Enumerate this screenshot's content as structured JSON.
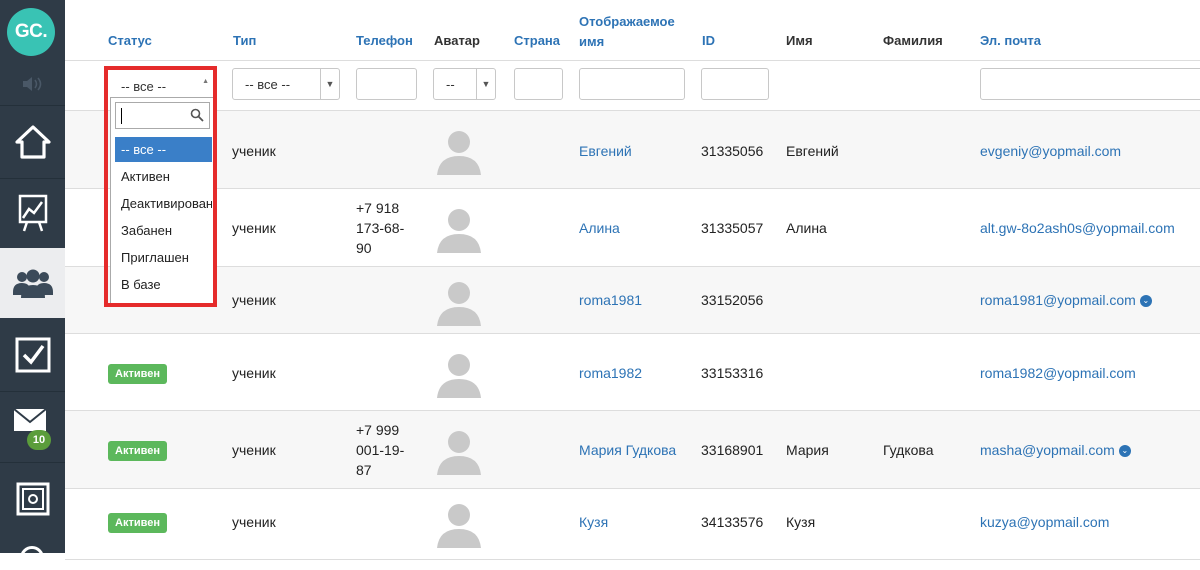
{
  "logo": {
    "text": "GC."
  },
  "sidebar": {
    "items": [
      {
        "name": "home-icon"
      },
      {
        "name": "chart-icon"
      },
      {
        "name": "users-icon"
      },
      {
        "name": "checkbox-icon"
      },
      {
        "name": "mail-icon",
        "badge": "10"
      },
      {
        "name": "safe-icon"
      }
    ]
  },
  "table": {
    "headers": {
      "status": "Статус",
      "type": "Тип",
      "phone": "Телефон",
      "avatar": "Аватар",
      "country": "Страна",
      "display_name_1": "Отображаемое",
      "display_name_2": "имя",
      "id": "ID",
      "first_name": "Имя",
      "last_name": "Фамилия",
      "email": "Эл. почта"
    },
    "filters": {
      "status": "-- все --",
      "type": "-- все --",
      "avatar": "--"
    },
    "rows": [
      {
        "status": "",
        "type": "ученик",
        "phone": [
          "",
          "",
          ""
        ],
        "display_name": "Евгений",
        "id": "31335056",
        "first_name": "Евгений",
        "last_name": "",
        "email": "evgeniy@yopmail.com"
      },
      {
        "status": "",
        "type": "ученик",
        "phone": [
          "+7 918",
          "173-68-",
          "90"
        ],
        "display_name": "Алина",
        "id": "31335057",
        "first_name": "Алина",
        "last_name": "",
        "email": "alt.gw-8o2ash0s@yopmail.com"
      },
      {
        "status": "",
        "type": "ученик",
        "phone": [
          "",
          "",
          ""
        ],
        "display_name": "roma1981",
        "id": "33152056",
        "first_name": "",
        "last_name": "",
        "email": "roma1981@yopmail.com"
      },
      {
        "status": "Активен",
        "type": "ученик",
        "phone": [
          "",
          "",
          ""
        ],
        "display_name": "roma1982",
        "id": "33153316",
        "first_name": "",
        "last_name": "",
        "email": "roma1982@yopmail.com"
      },
      {
        "status": "Активен",
        "type": "ученик",
        "phone": [
          "+7 999",
          "001-19-",
          "87"
        ],
        "display_name": "Мария Гудкова",
        "id": "33168901",
        "first_name": "Мария",
        "last_name": "Гудкова",
        "email": "masha@yopmail.com"
      },
      {
        "status": "Активен",
        "type": "ученик",
        "phone": [
          "",
          "",
          ""
        ],
        "display_name": "Кузя",
        "id": "34133576",
        "first_name": "Кузя",
        "last_name": "",
        "email": "kuzya@yopmail.com"
      }
    ]
  },
  "status_dropdown": {
    "current": "-- все --",
    "options": [
      "-- все --",
      "Активен",
      "Деактивирован",
      "Забанен",
      "Приглашен",
      "В базе"
    ],
    "selected_index": 0
  },
  "colors": {
    "sidebar": "#2f3b47",
    "logo": "#39c3b4",
    "link": "#2d73b5",
    "status_badge": "#5cb85c",
    "highlight_box": "#e52b2b"
  }
}
